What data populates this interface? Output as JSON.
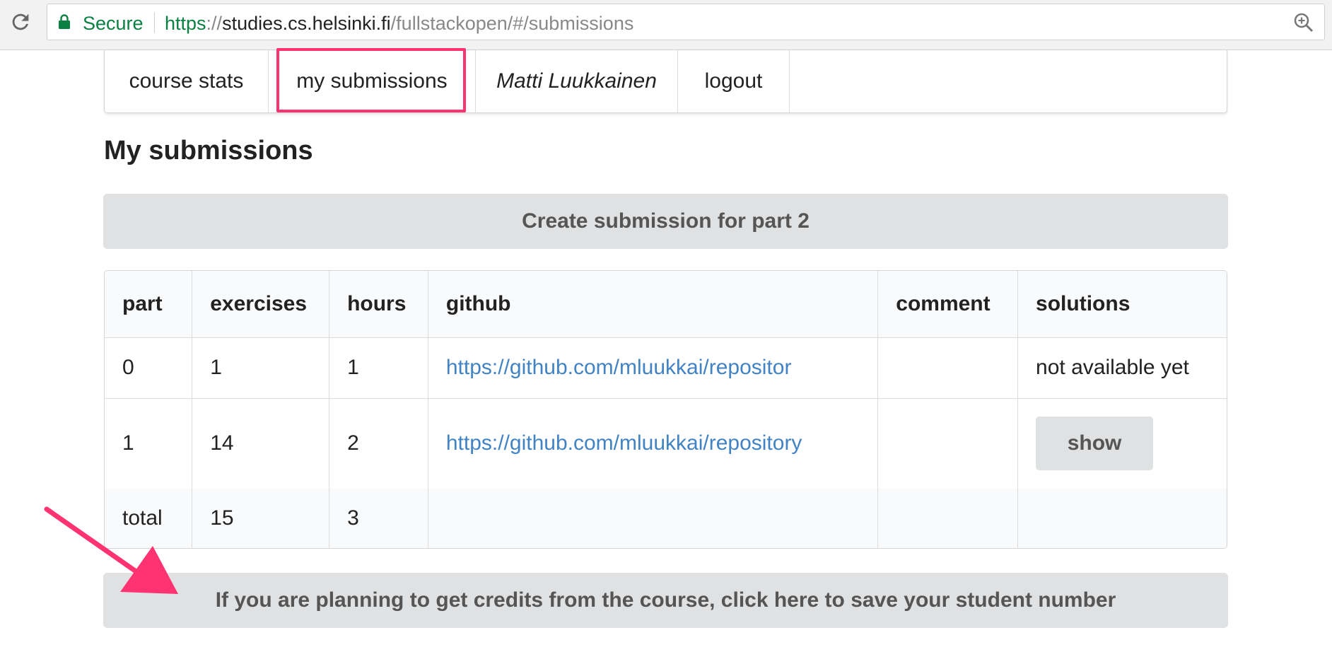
{
  "browser": {
    "secure_label": "Secure",
    "url_scheme": "https",
    "url_slashes": "://",
    "url_host": "studies.cs.helsinki.fi",
    "url_path": "/fullstackopen/#/submissions"
  },
  "nav": {
    "items": [
      {
        "label": "course stats"
      },
      {
        "label": "my submissions"
      },
      {
        "label": "Matti Luukkainen"
      },
      {
        "label": "logout"
      }
    ]
  },
  "page": {
    "title": "My submissions",
    "create_button": "Create submission for part 2",
    "credits_button": "If you are planning to get credits from the course, click here to save your student number"
  },
  "table": {
    "headers": [
      "part",
      "exercises",
      "hours",
      "github",
      "comment",
      "solutions"
    ],
    "rows": [
      {
        "part": "0",
        "exercises": "1",
        "hours": "1",
        "github": "https://github.com/mluukkai/repositor",
        "comment": "",
        "solutions": "not available yet"
      },
      {
        "part": "1",
        "exercises": "14",
        "hours": "2",
        "github": "https://github.com/mluukkai/repository",
        "comment": "",
        "solutions": "show"
      }
    ],
    "total": {
      "label": "total",
      "exercises": "15",
      "hours": "3"
    }
  },
  "colors": {
    "highlight": "#ff3372",
    "link": "#4183c4",
    "secure": "#0b8043"
  },
  "icons": [
    "reload-icon",
    "lock-icon",
    "zoom-icon",
    "arrow-annotation"
  ]
}
